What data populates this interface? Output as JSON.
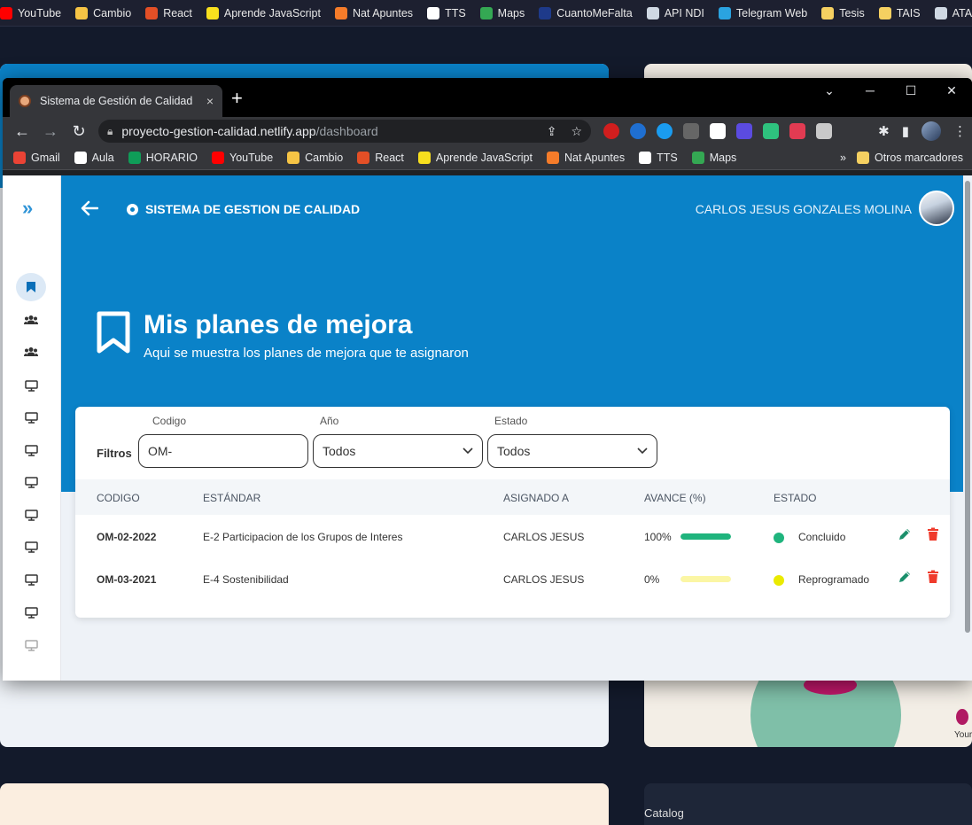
{
  "outer_bookmarks": [
    {
      "label": "YouTube",
      "color": "#ff0000"
    },
    {
      "label": "Cambio",
      "color": "#f6c445"
    },
    {
      "label": "React",
      "color": "#e34f26"
    },
    {
      "label": "Aprende JavaScript",
      "color": "#f7df1e"
    },
    {
      "label": "Nat Apuntes",
      "color": "#f57c2a"
    },
    {
      "label": "TTS",
      "color": "#ffffff"
    },
    {
      "label": "Maps",
      "color": "#34a853"
    },
    {
      "label": "CuantoMeFalta",
      "color": "#1e3a8a"
    },
    {
      "label": "API NDI",
      "color": "#cfd8e3"
    },
    {
      "label": "Telegram Web",
      "color": "#2aa3e0"
    },
    {
      "label": "Tesis",
      "color": "#f5d061"
    },
    {
      "label": "TAIS",
      "color": "#f5d061"
    },
    {
      "label": "ATA",
      "color": "#cfd8e3"
    }
  ],
  "tab": {
    "title": "Sistema de Gestión de Calidad",
    "close": "×"
  },
  "window_controls": {
    "minimize": "─",
    "maximize": "☐",
    "close": "✕",
    "dropdown": "⌄"
  },
  "address": {
    "host": "proyecto-gestion-calidad.netlify.app",
    "path": "/dashboard"
  },
  "bookmarks": [
    {
      "label": "Gmail",
      "color": "#ea4335"
    },
    {
      "label": "Aula",
      "color": "#ffffff"
    },
    {
      "label": "HORARIO",
      "color": "#0f9d58"
    },
    {
      "label": "YouTube",
      "color": "#ff0000"
    },
    {
      "label": "Cambio",
      "color": "#f6c445"
    },
    {
      "label": "React",
      "color": "#e34f26"
    },
    {
      "label": "Aprende JavaScript",
      "color": "#f7df1e"
    },
    {
      "label": "Nat Apuntes",
      "color": "#f57c2a"
    },
    {
      "label": "TTS",
      "color": "#ffffff"
    },
    {
      "label": "Maps",
      "color": "#34a853"
    }
  ],
  "bookmarks_more": "»",
  "other_bookmarks": "Otros marcadores",
  "app": {
    "brand": "SISTEMA DE GESTION DE CALIDAD",
    "user_name": "CARLOS JESUS GONZALES MOLINA",
    "heading": "Mis planes de mejora",
    "subheading": "Aqui se muestra los planes de mejora que te asignaron"
  },
  "filters": {
    "label": "Filtros",
    "codigo": {
      "label": "Codigo",
      "value": "OM-"
    },
    "anio": {
      "label": "Año",
      "value": "Todos"
    },
    "estado": {
      "label": "Estado",
      "value": "Todos"
    }
  },
  "table": {
    "headers": [
      "CODIGO",
      "ESTÁNDAR",
      "ASIGNADO A",
      "AVANCE (%)",
      "ESTADO"
    ],
    "rows": [
      {
        "codigo": "OM-02-2022",
        "estandar": "E-2 Participacion de los Grupos de Interes",
        "asignado": "CARLOS JESUS",
        "avance_label": "100%",
        "avance": 100,
        "bar_color": "#1fb47d",
        "estado": "Concluido",
        "estado_color": "#1fb47d"
      },
      {
        "codigo": "OM-03-2021",
        "estandar": "E-4 Sostenibilidad",
        "asignado": "CARLOS JESUS",
        "avance_label": "0%",
        "avance": 0,
        "bar_color": "#fbf6a4",
        "estado": "Reprogramado",
        "estado_color": "#eaea00"
      }
    ]
  },
  "background": {
    "catalog_text": "Catalog",
    "promo_text": "Your"
  },
  "colors": {
    "primary": "#0a82c8",
    "edit": "#1a8f6b",
    "delete": "#ef3b2c"
  }
}
